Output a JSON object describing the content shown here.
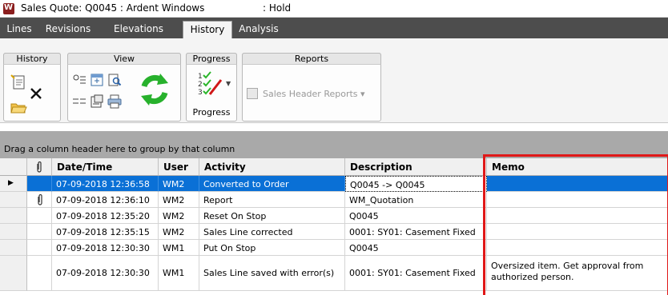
{
  "window": {
    "title": "Sales Quote: Q0045  : Ardent Windows",
    "status": ": Hold"
  },
  "tabs": [
    {
      "label": "Lines",
      "active": false
    },
    {
      "label": "Revisions",
      "active": false
    },
    {
      "label": "Elevations",
      "active": false
    },
    {
      "label": "History",
      "active": true
    },
    {
      "label": "Analysis",
      "active": false
    }
  ],
  "ribbon": {
    "groups": {
      "history": "History",
      "view": "View",
      "progress": "Progress",
      "reports": "Reports"
    },
    "progress_button_label": "Progress",
    "reports_button_label": "Sales Header Reports"
  },
  "groupby_hint": "Drag a column header here to group by that column",
  "grid": {
    "columns": [
      "Date/Time",
      "User",
      "Activity",
      "Description",
      "Memo"
    ],
    "rows": [
      {
        "datetime": "07-09-2018 12:36:58",
        "user": "WM2",
        "activity": "Converted to Order",
        "description": "Q0045 -> Q0045",
        "memo": "",
        "attachment": false,
        "selected": true
      },
      {
        "datetime": "07-09-2018 12:36:10",
        "user": "WM2",
        "activity": "Report",
        "description": "WM_Quotation",
        "memo": "",
        "attachment": true,
        "selected": false
      },
      {
        "datetime": "07-09-2018 12:35:20",
        "user": "WM2",
        "activity": "Reset On Stop",
        "description": "Q0045",
        "memo": "",
        "attachment": false,
        "selected": false
      },
      {
        "datetime": "07-09-2018 12:35:15",
        "user": "WM2",
        "activity": "Sales Line corrected",
        "description": "0001: SY01: Casement Fixed",
        "memo": "",
        "attachment": false,
        "selected": false
      },
      {
        "datetime": "07-09-2018 12:30:30",
        "user": "WM1",
        "activity": "Put On Stop",
        "description": "Q0045",
        "memo": "",
        "attachment": false,
        "selected": false
      },
      {
        "datetime": "07-09-2018 12:30:30",
        "user": "WM1",
        "activity": "Sales Line saved with error(s)",
        "description": "0001: SY01: Casement Fixed",
        "memo_line1": "Oversized item. Get approval from",
        "memo_line2": "authorized person.",
        "attachment": false,
        "selected": false
      }
    ]
  },
  "colors": {
    "tabbar": "#4d4d4d",
    "selection": "#0a70d6",
    "highlight_box": "#e01818"
  }
}
